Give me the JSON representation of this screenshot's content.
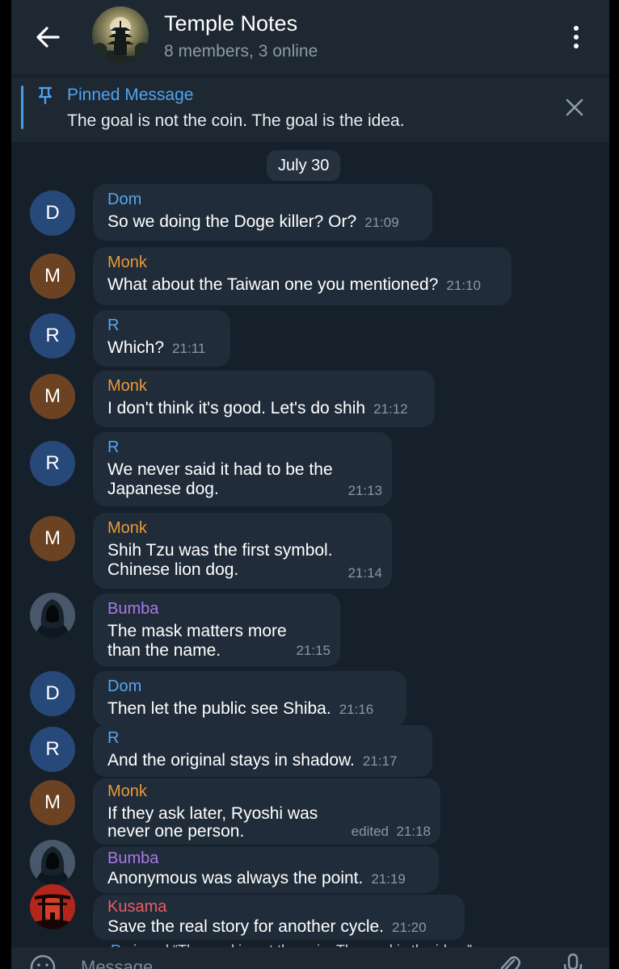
{
  "header": {
    "title": "Temple Notes",
    "subtitle": "8 members, 3 online",
    "back_icon": "arrow-left-icon",
    "menu_icon": "more-vertical-icon"
  },
  "pinned": {
    "title": "Pinned Message",
    "text": "The goal is not the coin. The goal is the idea.",
    "icon": "pin-icon",
    "close_icon": "close-icon"
  },
  "chat": {
    "date": "July 30",
    "messages": [
      {
        "initial": "D",
        "sender": "Dom",
        "text": "So we doing the Doge killer? Or?",
        "time": "21:09"
      },
      {
        "initial": "M",
        "sender": "Monk",
        "text": "What about the Taiwan one you mentioned?",
        "time": "21:10"
      },
      {
        "initial": "R",
        "sender": "R",
        "text": "Which?",
        "time": "21:11"
      },
      {
        "initial": "M",
        "sender": "Monk",
        "text": "I don't think it's good. Let's do shih",
        "time": "21:12"
      },
      {
        "initial": "R",
        "sender": "R",
        "line1": "We never said it had to be the",
        "line2": "Japanese dog.",
        "time": "21:13"
      },
      {
        "initial": "M",
        "sender": "Monk",
        "line1": "Shih Tzu was the first symbol.",
        "line2": "Chinese lion dog.",
        "time": "21:14"
      },
      {
        "sender": "Bumba",
        "line1": "The mask matters more",
        "line2": "than the name.",
        "time": "21:15"
      },
      {
        "initial": "D",
        "sender": "Dom",
        "text": "Then let the public see Shiba.",
        "time": "21:16"
      },
      {
        "initial": "R",
        "sender": "R",
        "text": "And the original stays in shadow.",
        "time": "21:17"
      },
      {
        "initial": "M",
        "sender": "Monk",
        "line1": "If they ask later, Ryoshi was",
        "line2": "never one person.",
        "edited": "edited",
        "time": "21:18"
      },
      {
        "sender": "Bumba",
        "text": "Anonymous was always the point.",
        "time": "21:19"
      },
      {
        "sender": "Kusama",
        "text": "Save the real story for another cycle.",
        "time": "21:20"
      }
    ],
    "service": {
      "actor": "R",
      "text": " pinned “The goal is not the coin. The goal is the idea.”"
    }
  },
  "composer": {
    "placeholder": "Message",
    "emoji_icon": "emoji-icon",
    "attach_icon": "paperclip-icon",
    "mic_icon": "microphone-icon"
  },
  "colors": {
    "background": "#16202b",
    "bubble": "#202c39",
    "accent": "#4ea4f2",
    "name_blue": "#58a6f0",
    "name_orange": "#eb9a36",
    "name_purple": "#a87be8",
    "name_red": "#ec5d60"
  }
}
